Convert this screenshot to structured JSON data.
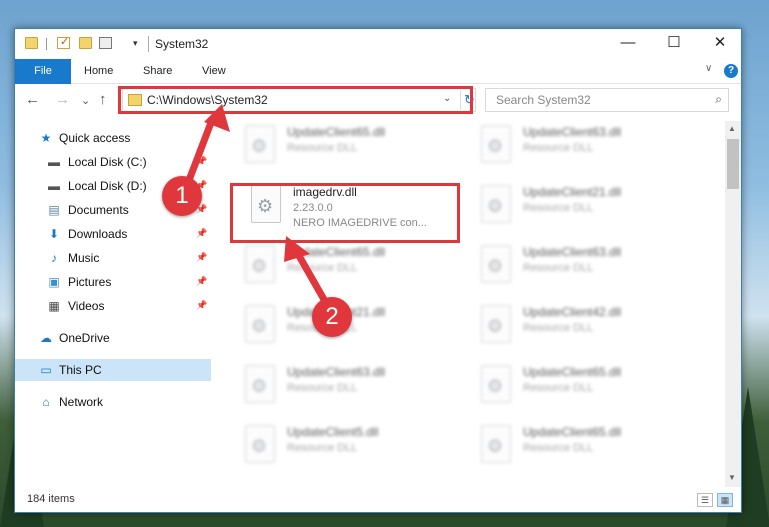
{
  "window": {
    "title": "System32",
    "quick_access_drop": "▾",
    "controls": {
      "minimize": "—",
      "maximize": "☐",
      "close": "✕"
    }
  },
  "ribbon": {
    "tabs": [
      "File",
      "Home",
      "Share",
      "View"
    ],
    "chevron": "∨",
    "help": "?"
  },
  "navigation": {
    "back": "←",
    "forward": "→",
    "recent": "⌄",
    "up": "↑",
    "address": "C:\\Windows\\System32",
    "address_drop": "⌄",
    "refresh": "↻",
    "search_placeholder": "Search System32",
    "search_icon": "⌕"
  },
  "sidebar": {
    "items": [
      {
        "label": "Quick access",
        "icon": "star-icon",
        "glyph": "★",
        "color": "#1979ca",
        "pinned": false
      },
      {
        "label": "Local Disk (C:)",
        "icon": "drive-icon",
        "glyph": "▬",
        "color": "#555555",
        "pinned": true
      },
      {
        "label": "Local Disk (D:)",
        "icon": "drive-icon",
        "glyph": "▬",
        "color": "#555555",
        "pinned": true
      },
      {
        "label": "Documents",
        "icon": "documents-icon",
        "glyph": "▤",
        "color": "#5a7ea8",
        "pinned": true
      },
      {
        "label": "Downloads",
        "icon": "downloads-icon",
        "glyph": "⬇",
        "color": "#1979ca",
        "pinned": true
      },
      {
        "label": "Music",
        "icon": "music-icon",
        "glyph": "♪",
        "color": "#1979ca",
        "pinned": true
      },
      {
        "label": "Pictures",
        "icon": "pictures-icon",
        "glyph": "▣",
        "color": "#3b8fd0",
        "pinned": true
      },
      {
        "label": "Videos",
        "icon": "videos-icon",
        "glyph": "▦",
        "color": "#444444",
        "pinned": true
      },
      {
        "label": "OneDrive",
        "icon": "onedrive-icon",
        "glyph": "☁",
        "color": "#1979ca",
        "pinned": false
      },
      {
        "label": "This PC",
        "icon": "this-pc-icon",
        "glyph": "▭",
        "color": "#1979ca",
        "pinned": false
      },
      {
        "label": "Network",
        "icon": "network-icon",
        "glyph": "⌂",
        "color": "#1979ca",
        "pinned": false
      }
    ],
    "pin_glyph": "📌"
  },
  "files": [
    {
      "name": "UpdateClient65.dll",
      "desc": "Resource DLL",
      "blurred": true
    },
    {
      "name": "UpdateClient63.dll",
      "desc": "Resource DLL",
      "blurred": true
    },
    {
      "name": "imagedrv.dll",
      "desc": "2.23.0.0",
      "desc2": "NERO IMAGEDRIVE con...",
      "blurred": false
    },
    {
      "name": "UpdateClient21.dll",
      "desc": "Resource DLL",
      "blurred": true
    },
    {
      "name": "UpdateClient65.dll",
      "desc": "Resource DLL",
      "blurred": true
    },
    {
      "name": "UpdateClient63.dll",
      "desc": "Resource DLL",
      "blurred": true
    },
    {
      "name": "UpdateClient21.dll",
      "desc": "Resource DLL",
      "blurred": true
    },
    {
      "name": "UpdateClient42.dll",
      "desc": "Resource DLL",
      "blurred": true
    },
    {
      "name": "UpdateClient63.dll",
      "desc": "Resource DLL",
      "blurred": true
    },
    {
      "name": "UpdateClient65.dll",
      "desc": "Resource DLL",
      "blurred": true
    },
    {
      "name": "UpdateClient5.dll",
      "desc": "Resource DLL",
      "blurred": true
    },
    {
      "name": "UpdateClient65.dll",
      "desc": "Resource DLL",
      "blurred": true
    }
  ],
  "status": {
    "item_count": "184 items",
    "details_view": "☰",
    "tiles_view": "▦"
  },
  "annotations": {
    "step1": "1",
    "step2": "2",
    "color": "#e0373d"
  }
}
